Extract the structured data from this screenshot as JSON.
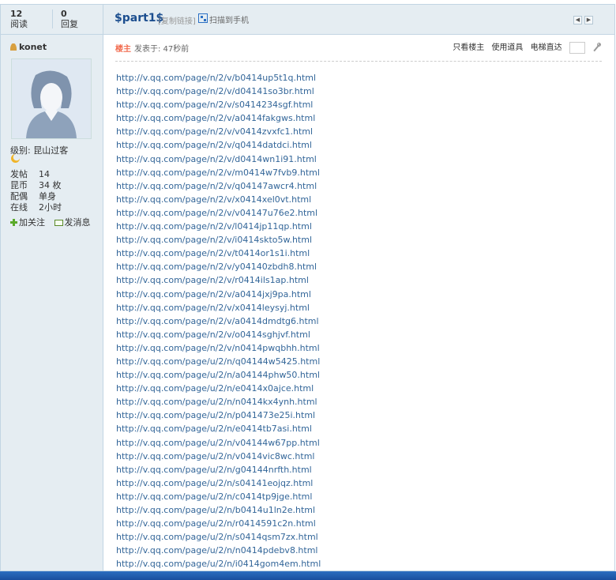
{
  "stats": {
    "views_count": "12",
    "views_label": "阅读",
    "replies_count": "0",
    "replies_label": "回复"
  },
  "thread": {
    "title": "$part1$",
    "copy_link": "[复制链接]",
    "qr_label": "扫描到手机"
  },
  "author": {
    "name": "konet",
    "level": "级别: 昆山过客",
    "profile": [
      {
        "key": "发帖",
        "value": "14"
      },
      {
        "key": "昆币",
        "value": "34 枚"
      },
      {
        "key": "配偶",
        "value": "单身"
      },
      {
        "key": "在线",
        "value": "2小时"
      }
    ],
    "follow_label": "加关注",
    "message_label": "发消息"
  },
  "post": {
    "badge": "楼主",
    "posted": "发表于: 47秒前",
    "tools": {
      "author_only": "只看楼主",
      "use_item": "使用道具",
      "floor_jump": "电梯直达"
    },
    "links": [
      "http://v.qq.com/page/n/2/v/b0414up5t1q.html",
      "http://v.qq.com/page/n/2/v/d04141so3br.html",
      "http://v.qq.com/page/n/2/v/s0414234sgf.html",
      "http://v.qq.com/page/n/2/v/a0414fakgws.html",
      "http://v.qq.com/page/n/2/v/v0414zvxfc1.html",
      "http://v.qq.com/page/n/2/v/q0414datdci.html",
      "http://v.qq.com/page/n/2/v/d0414wn1i91.html",
      "http://v.qq.com/page/n/2/v/m0414w7fvb9.html",
      "http://v.qq.com/page/n/2/v/q04147awcr4.html",
      "http://v.qq.com/page/n/2/v/x0414xel0vt.html",
      "http://v.qq.com/page/n/2/v/v04147u76e2.html",
      "http://v.qq.com/page/n/2/v/l0414jp11qp.html",
      "http://v.qq.com/page/n/2/v/i0414skto5w.html",
      "http://v.qq.com/page/n/2/v/t0414or1s1i.html",
      "http://v.qq.com/page/n/2/v/y04140zbdh8.html",
      "http://v.qq.com/page/n/2/v/r0414ils1ap.html",
      "http://v.qq.com/page/n/2/v/a0414jxj9pa.html",
      "http://v.qq.com/page/n/2/v/x0414leysyj.html",
      "http://v.qq.com/page/n/2/v/a0414dmdtg6.html",
      "http://v.qq.com/page/n/2/v/o0414sghjvf.html",
      "http://v.qq.com/page/n/2/v/n0414pwqbhh.html",
      "http://v.qq.com/page/u/2/n/q04144w5425.html",
      "http://v.qq.com/page/u/2/n/a04144phw50.html",
      "http://v.qq.com/page/u/2/n/e0414x0ajce.html",
      "http://v.qq.com/page/u/2/n/n0414kx4ynh.html",
      "http://v.qq.com/page/u/2/n/p041473e25i.html",
      "http://v.qq.com/page/u/2/n/e0414tb7asi.html",
      "http://v.qq.com/page/u/2/n/v04144w67pp.html",
      "http://v.qq.com/page/u/2/n/v0414vic8wc.html",
      "http://v.qq.com/page/u/2/n/g04144nrfth.html",
      "http://v.qq.com/page/u/2/n/s04141eojqz.html",
      "http://v.qq.com/page/u/2/n/c0414tp9jge.html",
      "http://v.qq.com/page/u/2/n/b0414u1ln2e.html",
      "http://v.qq.com/page/u/2/n/r0414591c2n.html",
      "http://v.qq.com/page/u/2/n/s0414qsm7zx.html",
      "http://v.qq.com/page/u/2/n/n0414pdebv8.html",
      "http://v.qq.com/page/u/2/n/i0414gom4em.html"
    ]
  },
  "colors": {
    "header_bg": "#e5edf2",
    "border": "#c2d5e3",
    "link": "#336699",
    "title": "#1c4e8f",
    "badge": "#f26c4f"
  }
}
